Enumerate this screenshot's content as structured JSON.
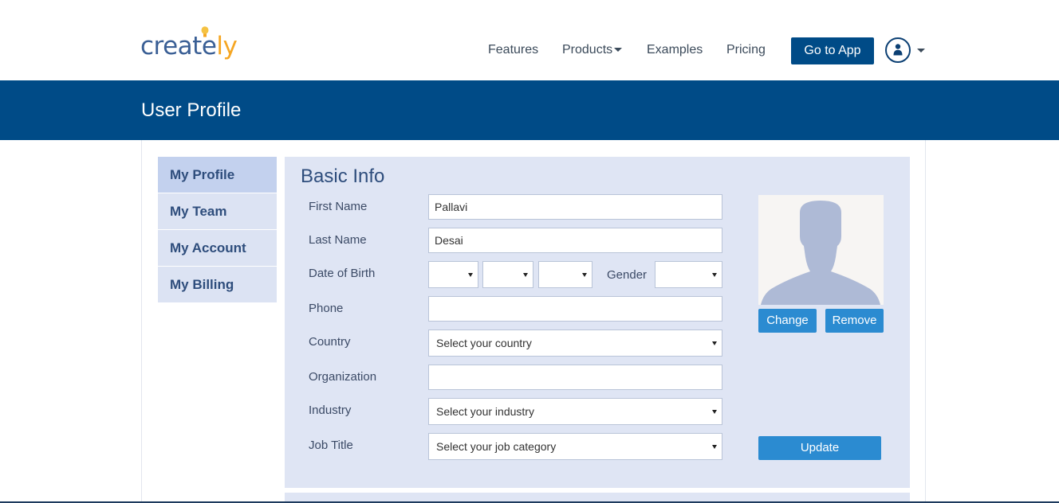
{
  "header": {
    "logo_part1": "creat",
    "logo_part2": "e",
    "logo_part3": "ly",
    "nav": {
      "features": "Features",
      "products": "Products",
      "examples": "Examples",
      "pricing": "Pricing"
    },
    "go_to_app": "Go to App",
    "avatar_icon": "user-icon"
  },
  "banner": {
    "title": "User Profile"
  },
  "sidebar": {
    "items": [
      {
        "label": "My Profile",
        "active": true
      },
      {
        "label": "My Team"
      },
      {
        "label": "My Account"
      },
      {
        "label": "My Billing"
      }
    ]
  },
  "basic_info": {
    "title": "Basic Info",
    "first_name": {
      "label": "First Name",
      "value": "Pallavi"
    },
    "last_name": {
      "label": "Last Name",
      "value": "Desai"
    },
    "dob": {
      "label": "Date of Birth",
      "day": "",
      "month": "",
      "year": ""
    },
    "gender": {
      "label": "Gender",
      "value": ""
    },
    "phone": {
      "label": "Phone",
      "value": ""
    },
    "country": {
      "label": "Country",
      "value": "Select your country"
    },
    "organization": {
      "label": "Organization",
      "value": ""
    },
    "industry": {
      "label": "Industry",
      "value": "Select your industry"
    },
    "job_title": {
      "label": "Job Title",
      "value": "Select your job category"
    }
  },
  "photo": {
    "change_label": "Change",
    "remove_label": "Remove"
  },
  "update_label": "Update",
  "colors": {
    "brand_blue": "#004b87",
    "button_blue": "#2b8bd1",
    "panel_bg": "#dfe5f4",
    "logo_orange": "#f5a623"
  }
}
